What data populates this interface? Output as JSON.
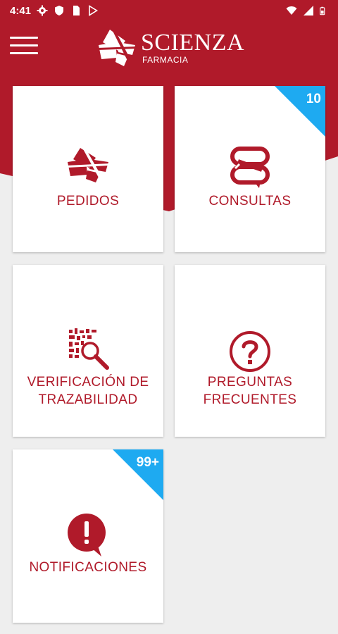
{
  "status_bar": {
    "time": "4:41",
    "left_icons": [
      "gear-icon",
      "shield-icon",
      "sim-card-icon",
      "play-store-icon"
    ],
    "right_icons": [
      "wifi-icon",
      "signal-icon",
      "battery-icon"
    ]
  },
  "app_bar": {
    "brand": "SCIENZA",
    "brand_sub": "FARMACIA",
    "menu_icon": "hamburger-menu-icon"
  },
  "colors": {
    "primary": "#b01a2a",
    "badge": "#1eaaf1",
    "background": "#eeeeee",
    "card": "#ffffff"
  },
  "tiles": [
    {
      "label": "PEDIDOS",
      "icon": "scienza-logo-icon",
      "badge": ""
    },
    {
      "label": "CONSULTAS",
      "icon": "chat-bubbles-icon",
      "badge": "10"
    },
    {
      "label": "VERIFICACIÓN DE\nTRAZABILIDAD",
      "icon": "barcode-magnifier-icon",
      "badge": ""
    },
    {
      "label": "PREGUNTAS\nFRECUENTES",
      "icon": "question-circle-icon",
      "badge": ""
    },
    {
      "label": "NOTIFICACIONES",
      "icon": "exclamation-bubble-icon",
      "badge": "99+"
    }
  ]
}
